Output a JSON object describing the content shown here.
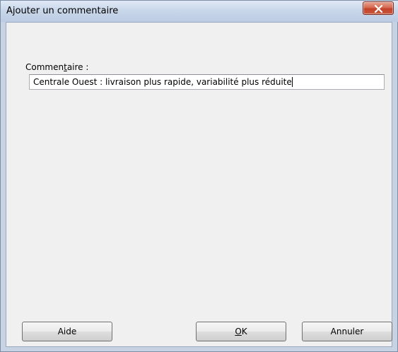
{
  "window": {
    "title": "Ajouter un commentaire",
    "close_glyph": "✕"
  },
  "form": {
    "label_prefix": "Commen",
    "label_mnemonic": "t",
    "label_suffix": "aire :",
    "comment_value": "Centrale Ouest : livraison plus rapide, variabilité plus réduite"
  },
  "buttons": {
    "aide": "Aide",
    "ok_mnemonic": "O",
    "ok_suffix": "K",
    "annuler": "Annuler"
  },
  "icons": {
    "close": "close-icon"
  },
  "colors": {
    "close_button": "#c24329",
    "dialog_background": "#f0f0f0",
    "frame": "#c7d3e2"
  }
}
